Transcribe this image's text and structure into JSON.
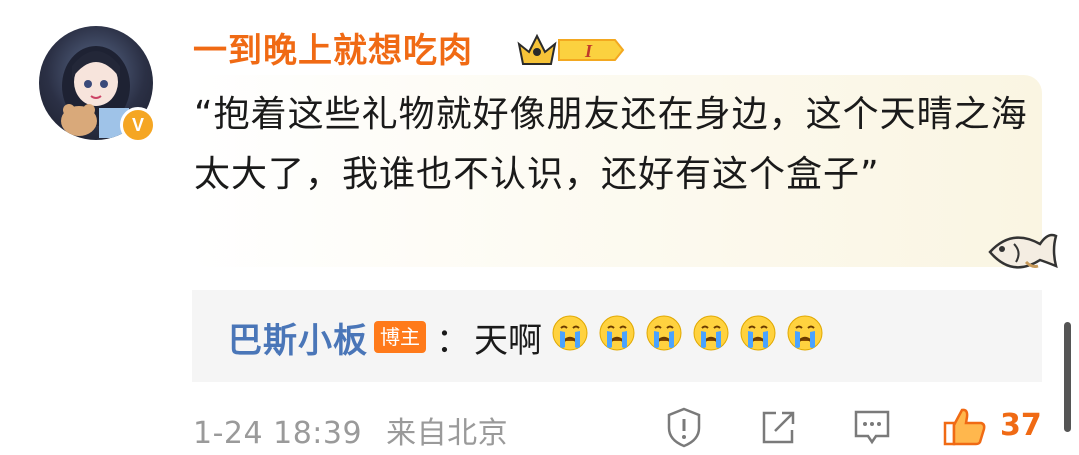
{
  "comment": {
    "username": "一到晚上就想吃肉",
    "badge_level": "I",
    "text": "“抱着这些礼物就好像朋友还在身边，这个天晴之海太大了，我谁也不认识，还好有这个盒子”"
  },
  "reply": {
    "username": "巴斯小板",
    "tag": "博主",
    "colon": "：",
    "text": "天啊",
    "emoji_count": 6,
    "emoji": "crying-face"
  },
  "footer": {
    "time": "1-24 18:39",
    "location": "来自北京",
    "like_count": "37"
  },
  "colors": {
    "username": "#f06a14",
    "reply_user": "#4a76b8",
    "tag_bg": "#ff7a1a",
    "like": "#f06a14",
    "meta": "#9a9a9a"
  },
  "icons": [
    "avatar",
    "verified-icon",
    "crown-badge-icon",
    "fish-decoration-icon",
    "crying-face-icon",
    "report-icon",
    "share-icon",
    "comment-icon",
    "like-icon"
  ]
}
